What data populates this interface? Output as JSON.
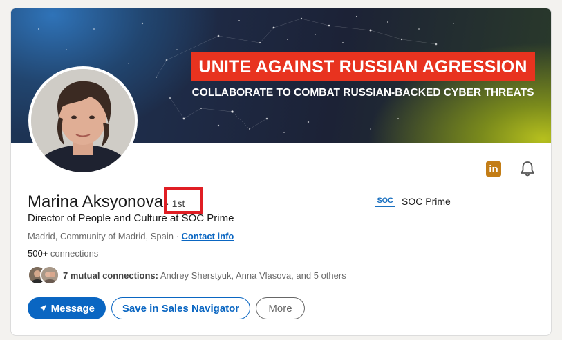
{
  "banner": {
    "headline": "UNITE AGAINST RUSSIAN AGRESSION",
    "subline": "COLLABORATE TO COMBAT RUSSIAN-BACKED CYBER THREATS"
  },
  "profile": {
    "name": "Marina Aksyonova",
    "degree": "· 1st",
    "title": "Director of People and Culture at SOC Prime",
    "location": "Madrid, Community of Madrid, Spain ·",
    "contact_info": "Contact info",
    "connections_count": "500+",
    "connections_label": "connections"
  },
  "company": {
    "logo_text": "SOC",
    "name": "SOC Prime"
  },
  "mutual": {
    "count_label": "7 mutual connections:",
    "names": "Andrey Sherstyuk, Anna Vlasova, and 5 others"
  },
  "actions": {
    "message": "Message",
    "sales_navigator": "Save in Sales Navigator",
    "more": "More"
  },
  "icons": {
    "linkedin": "linkedin-icon",
    "bell": "bell-icon",
    "send": "send-icon"
  },
  "colors": {
    "primary": "#0a66c2",
    "headline_bg": "#e8331f",
    "highlight": "#e01e24",
    "linkedin_icon": "#c37d16"
  }
}
